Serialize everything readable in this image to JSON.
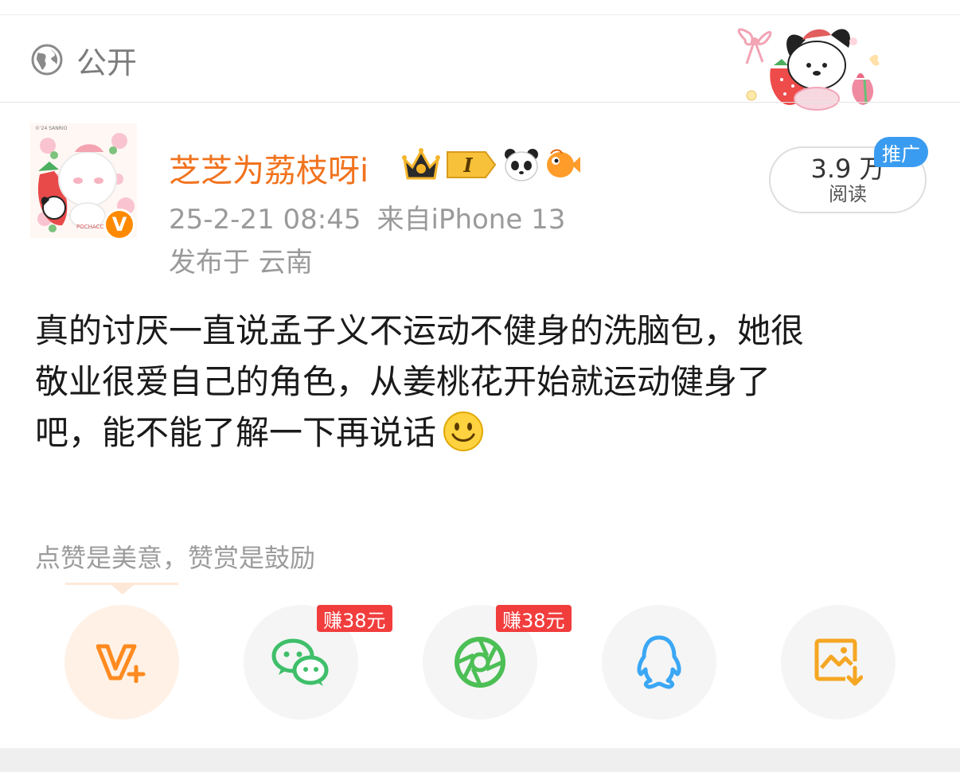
{
  "header": {
    "visibility_label": "公开"
  },
  "post": {
    "author": "芝芝为荔枝呀i",
    "time": "25-2-21 08:45",
    "source": "来自iPhone 13",
    "location": "发布于 云南",
    "reads": {
      "count": "3.9 万",
      "label": "阅读",
      "promo_badge": "推广"
    },
    "text_lines": [
      "真的讨厌一直说孟子义不运动不健身的洗脑包，她很",
      "敬业很爱自己的角色，从姜桃花开始就运动健身了",
      "吧，能不能了解一下再说话"
    ],
    "level_badge": "I",
    "verified_mark": "V"
  },
  "engagement": {
    "like_hint": "点赞是美意，赞赏是鼓励"
  },
  "share": {
    "buttons": [
      {
        "name": "v-plus",
        "icon": "v-plus-icon",
        "badge": ""
      },
      {
        "name": "wechat",
        "icon": "wechat-icon",
        "badge": "赚38元"
      },
      {
        "name": "moments",
        "icon": "moments-icon",
        "badge": "赚38元"
      },
      {
        "name": "qq",
        "icon": "qq-icon",
        "badge": ""
      },
      {
        "name": "save-image",
        "icon": "save-image-icon",
        "badge": ""
      }
    ]
  },
  "colors": {
    "username": "#f1731e",
    "accent_orange": "#ff8a00",
    "promo_blue": "#3a9cf0",
    "earn_red": "#f23d3d",
    "wechat_green": "#3fbf6a",
    "qq_blue": "#3ba7f5"
  }
}
